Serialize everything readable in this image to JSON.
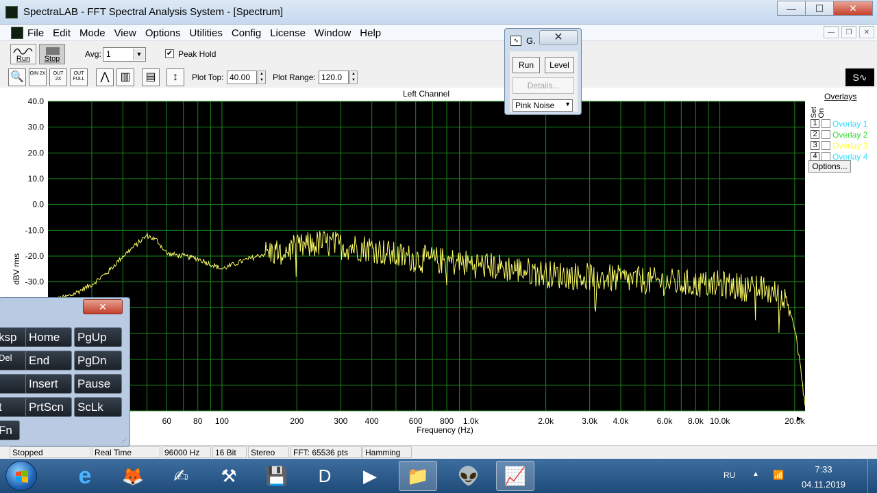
{
  "window": {
    "title": "SpectraLAB - FFT Spectral Analysis System - [Spectrum]",
    "minimize": "—",
    "maximize": "☐",
    "close": "✕"
  },
  "menu": {
    "items": [
      "File",
      "Edit",
      "Mode",
      "View",
      "Options",
      "Utilities",
      "Config",
      "License",
      "Window",
      "Help"
    ],
    "mdi": [
      "—",
      "❐",
      "✕"
    ]
  },
  "toolbar": {
    "run_label": "Run",
    "stop_label": "Stop",
    "avg_label": "Avg:",
    "avg_value": "1",
    "peak_hold_label": "Peak Hold",
    "peak_hold_checked": "✔",
    "tools": [
      {
        "name": "zoom-tool",
        "text": "🔍"
      },
      {
        "name": "zoom-in-2x-tool",
        "text": "OIN 2X"
      },
      {
        "name": "zoom-out-2x-tool",
        "text": "OUT 2X"
      },
      {
        "name": "zoom-out-full-tool",
        "text": "OUT FULL"
      },
      {
        "name": "line-plot-tool",
        "text": "⋀"
      },
      {
        "name": "bar-plot-tool",
        "text": "▥"
      },
      {
        "name": "overlay-tool",
        "text": "▤"
      },
      {
        "name": "scale-tool",
        "text": "↕"
      }
    ],
    "plot_top_label": "Plot Top:",
    "plot_top_value": "40.00",
    "plot_range_label": "Plot Range:",
    "plot_range_value": "120.0",
    "generator_logo": "S∿"
  },
  "chart_data": {
    "type": "line",
    "title": "Left Channel",
    "xlabel": "Frequency (Hz)",
    "ylabel": "dBV rms",
    "x_scale": "log",
    "ylim": [
      -80,
      40
    ],
    "yticks": [
      "40.0",
      "30.0",
      "20.0",
      "10.0",
      "0.0",
      "-10.0",
      "-20.0",
      "-30.0"
    ],
    "xticks": [
      "60",
      "80",
      "100",
      "200",
      "300",
      "400",
      "600",
      "800",
      "1.0k",
      "2.0k",
      "3.0k",
      "4.0k",
      "6.0k",
      "8.0k",
      "10.0k",
      "20.0k"
    ],
    "grid": true,
    "series_color": "#ffff66",
    "x": [
      20,
      25,
      30,
      35,
      40,
      50,
      55,
      60,
      70,
      80,
      100,
      120,
      150,
      200,
      250,
      300,
      400,
      500,
      600,
      800,
      1000,
      1500,
      2000,
      3000,
      4000,
      6000,
      8000,
      10000,
      15000,
      18000,
      19000,
      20000,
      21000,
      22000
    ],
    "y": [
      -38,
      -35,
      -31,
      -26,
      -20,
      -12,
      -14,
      -19,
      -20,
      -21,
      -25,
      -22,
      -19,
      -17,
      -15,
      -16,
      -17,
      -20,
      -21,
      -22,
      -23,
      -25,
      -27,
      -28,
      -29,
      -30,
      -31,
      -31,
      -33,
      -36,
      -40,
      -48,
      -62,
      -78
    ]
  },
  "overlays": {
    "title": "Overlays",
    "header": "Set On",
    "items": [
      {
        "num": "1",
        "name": "Overlay 1",
        "color": "#33ddff"
      },
      {
        "num": "2",
        "name": "Overlay 2",
        "color": "#33dd33"
      },
      {
        "num": "3",
        "name": "Overlay 3",
        "color": "#ffff33"
      },
      {
        "num": "4",
        "name": "Overlay 4",
        "color": "#33ddff"
      }
    ],
    "options_label": "Options..."
  },
  "status": {
    "state": "Stopped",
    "mode": "Real Time",
    "rate": "96000 Hz",
    "bits": "16 Bit",
    "channels": "Stereo",
    "fft": "FFT: 65536 pts",
    "window": "Hamming"
  },
  "generator": {
    "title": "G.",
    "close": "✕",
    "run_label": "Run",
    "level_label": "Level",
    "details_label": "Details...",
    "signal": "Pink Noise"
  },
  "keyboard": {
    "close": "✕",
    "keys": [
      {
        "label": "ksp",
        "name": "backspace-key"
      },
      {
        "label": "Home",
        "name": "home-key"
      },
      {
        "label": "PgUp",
        "name": "pgup-key"
      },
      {
        "label": "Del",
        "name": "delete-key"
      },
      {
        "label": "End",
        "name": "end-key"
      },
      {
        "label": "PgDn",
        "name": "pgdn-key"
      },
      {
        "label": "",
        "name": "enter-key"
      },
      {
        "label": "Insert",
        "name": "insert-key"
      },
      {
        "label": "Pause",
        "name": "pause-key"
      },
      {
        "label": "t",
        "name": "shift-key"
      },
      {
        "label": "PrtScn",
        "name": "prtscn-key"
      },
      {
        "label": "ScLk",
        "name": "sclk-key"
      },
      {
        "label": "Fn",
        "name": "fn-key"
      }
    ]
  },
  "taskbar": {
    "apps": [
      {
        "name": "internet-explorer-icon",
        "glyph": "e"
      },
      {
        "name": "firefox-icon",
        "glyph": "🦊"
      },
      {
        "name": "signature-app-icon",
        "glyph": "✍"
      },
      {
        "name": "tools-app-icon",
        "glyph": "⚒"
      },
      {
        "name": "save-app-icon",
        "glyph": "💾"
      },
      {
        "name": "d-app-icon",
        "glyph": "D"
      },
      {
        "name": "media-player-icon",
        "glyph": "▶"
      },
      {
        "name": "file-explorer-icon",
        "glyph": "📁"
      },
      {
        "name": "alien-app-icon",
        "glyph": "👽"
      },
      {
        "name": "spectralab-app-icon",
        "glyph": "📈"
      }
    ],
    "lang": "RU",
    "time": "7:33",
    "date": "04.11.2019"
  }
}
